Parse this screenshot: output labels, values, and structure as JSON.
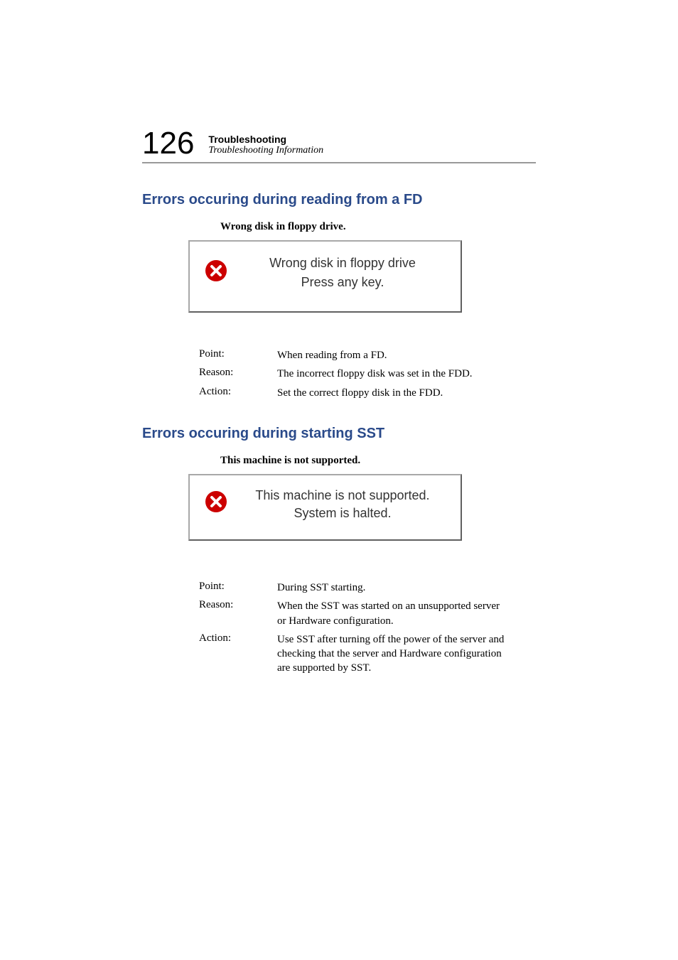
{
  "header": {
    "page_number": "126",
    "title": "Troubleshooting",
    "subtitle": "Troubleshooting Information"
  },
  "sections": [
    {
      "heading": "Errors occuring during reading from a FD",
      "error_title": "Wrong disk in floppy drive.",
      "dialog": {
        "line1": "Wrong disk in floppy drive",
        "line2": "Press any key."
      },
      "info": {
        "point_label": "Point:",
        "point_value": "When reading from a FD.",
        "reason_label": "Reason:",
        "reason_value": "The incorrect floppy disk was set in the FDD.",
        "action_label": "Action:",
        "action_value": "Set the correct floppy disk in the FDD."
      }
    },
    {
      "heading": "Errors occuring during starting SST",
      "error_title": "This machine is not supported.",
      "dialog": {
        "line1": "This machine is not supported.",
        "line2": "System is halted."
      },
      "info": {
        "point_label": "Point:",
        "point_value": "During SST starting.",
        "reason_label": "Reason:",
        "reason_value": "When the SST was started on an unsupported server or Hardware configuration.",
        "action_label": "Action:",
        "action_value": "Use SST after turning off the power of the server and checking that the server and Hardware configuration are supported by SST."
      }
    }
  ]
}
